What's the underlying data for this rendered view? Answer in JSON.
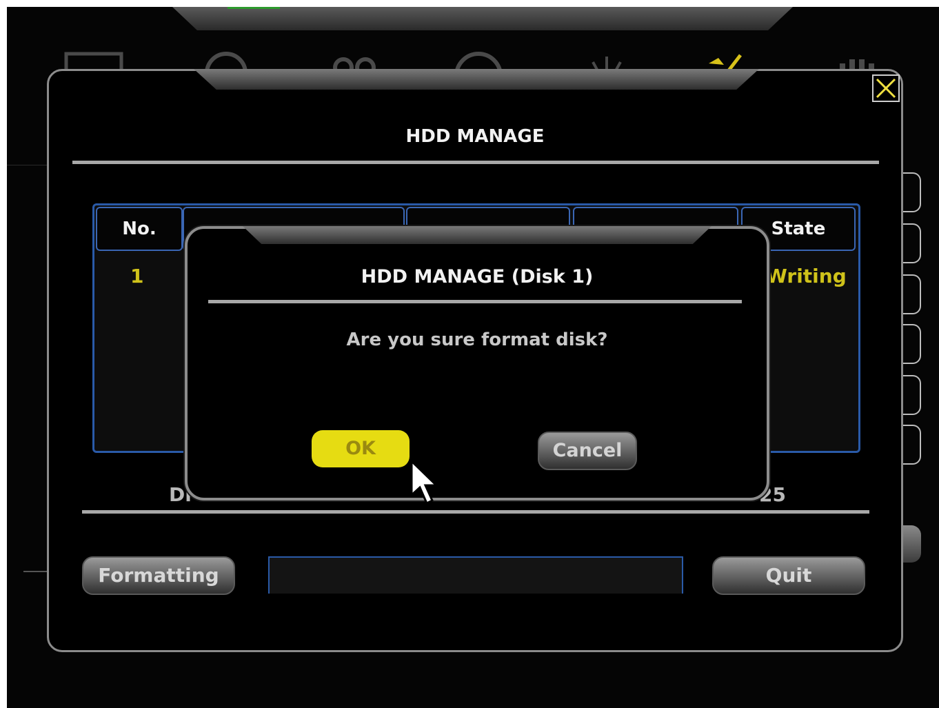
{
  "window": {
    "title": "HDD MANAGE",
    "close_label": "×"
  },
  "table": {
    "headers": [
      "No.",
      "",
      "",
      "",
      "State"
    ],
    "rows": [
      {
        "no": "1",
        "state": "Writing"
      }
    ]
  },
  "info": {
    "prefix": "Di",
    "suffix": "25"
  },
  "buttons": {
    "formatting": "Formatting",
    "quit": "Quit"
  },
  "dialog": {
    "title": "HDD MANAGE (Disk 1)",
    "message": "Are you sure format disk?",
    "ok": "OK",
    "cancel": "Cancel"
  },
  "colors": {
    "accent_yellow": "#e6dc12",
    "table_border": "#2a5aa8",
    "window_border": "#8c8c8c"
  }
}
